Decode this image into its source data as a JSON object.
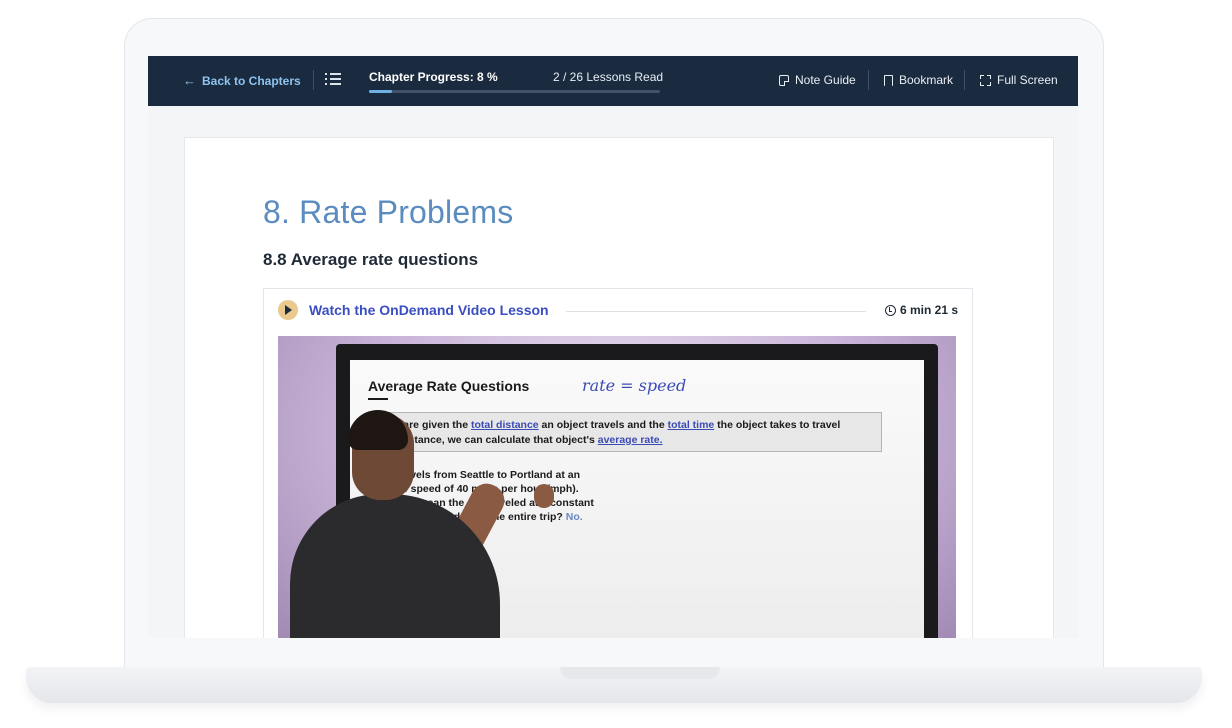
{
  "topbar": {
    "back_label": "Back to Chapters",
    "progress_label": "Chapter Progress: 8 %",
    "progress_fraction": 0.08,
    "lessons_read": "2 / 26 Lessons Read",
    "note_guide": "Note Guide",
    "bookmark": "Bookmark",
    "full_screen": "Full Screen",
    "accent": "#6fb0e6",
    "background": "#1b2b3f"
  },
  "content": {
    "chapter_title": "8. Rate Problems",
    "lesson_title": "8.8 Average rate questions"
  },
  "video": {
    "label": "Watch the OnDemand Video Lesson",
    "duration": "6 min 21 s",
    "slide": {
      "title": "Average Rate Questions",
      "handwriting": "rate = speed",
      "definition_part1": "If we are given the ",
      "definition_hl1": "total distance",
      "definition_part2": " an object travels and the ",
      "definition_hl2": "total time",
      "definition_part3": " the object takes to travel",
      "definition_line2a": "that distance, we can calculate that object's ",
      "definition_hl3": "average rate.",
      "question_line1": "A car travels from Seattle to Portland at an",
      "question_line2": "average speed of 40 miles per hour (mph).",
      "question_line3": "Does this mean the car traveled at a constant",
      "question_line4": "speed of 40 mph during the entire trip?",
      "answer": "No."
    }
  }
}
